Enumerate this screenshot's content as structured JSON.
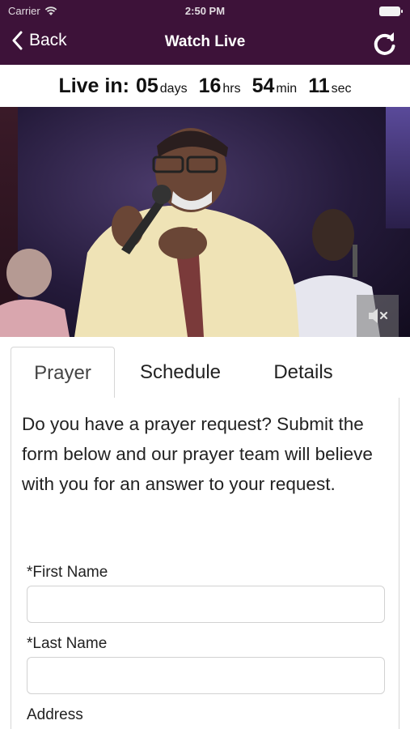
{
  "status_bar": {
    "carrier": "Carrier",
    "time": "2:50 PM"
  },
  "nav": {
    "back_label": "Back",
    "title": "Watch Live"
  },
  "countdown": {
    "label": "Live in:",
    "days": "05",
    "days_unit": "days",
    "hours": "16",
    "hours_unit": "hrs",
    "minutes": "54",
    "minutes_unit": "min",
    "seconds": "11",
    "seconds_unit": "sec"
  },
  "tabs": [
    {
      "label": "Prayer",
      "active": true
    },
    {
      "label": "Schedule",
      "active": false
    },
    {
      "label": "Details",
      "active": false
    }
  ],
  "prayer": {
    "intro": "Do you have a prayer request? Submit the form below and our prayer team will believe with you for an answer to your request.",
    "first_name_label": "*First Name",
    "first_name_value": "",
    "last_name_label": "*Last Name",
    "last_name_value": "",
    "address_label": "Address"
  },
  "colors": {
    "nav_bg": "#3d1239",
    "accent": "#ffffff"
  }
}
